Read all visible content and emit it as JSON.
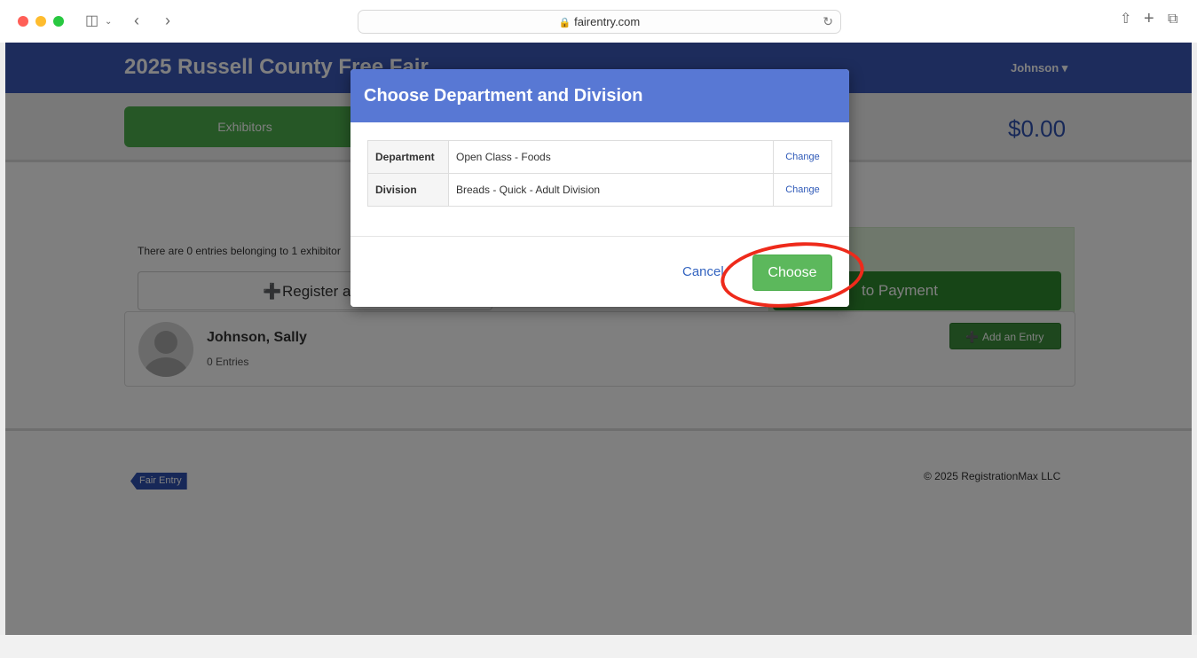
{
  "browser": {
    "url": "fairentry.com",
    "traffic_colors": [
      "#ff5f57",
      "#febc2e",
      "#28c840"
    ]
  },
  "site": {
    "title": "2025 Russell County Free Fair",
    "user_menu": "Johnson ▾",
    "exhibitors_tab": "Exhibitors",
    "total": "$0.00"
  },
  "summary_text": "There are 0 entries belonging to 1 exhibitor",
  "register_label": "Register an",
  "pay_label": "to Payment",
  "exhibitor": {
    "name": "Johnson, Sally",
    "entries": "0 Entries",
    "add_label": "Add an Entry"
  },
  "footer": {
    "logo": "Fair Entry",
    "copyright": "© 2025 RegistrationMax LLC"
  },
  "modal": {
    "title": "Choose Department and Division",
    "rows": [
      {
        "label": "Department",
        "value": "Open Class - Foods",
        "action": "Change"
      },
      {
        "label": "Division",
        "value": "Breads - Quick - Adult Division",
        "action": "Change"
      }
    ],
    "cancel_label": "Cancel",
    "choose_label": "Choose"
  },
  "colors": {
    "navbar": "#3a58b8",
    "modal_header": "#5878d4",
    "primary_green": "#5cb85c",
    "highlight": "#ee2a1b"
  }
}
